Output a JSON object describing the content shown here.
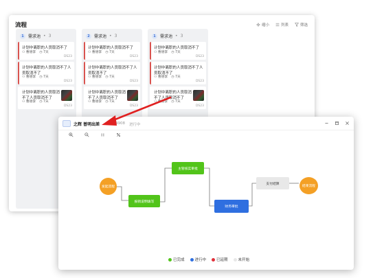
{
  "kanban": {
    "title": "流程",
    "tools": [
      {
        "label": "缩小",
        "icon": "shrink-icon"
      },
      {
        "label": "列表",
        "icon": "list-icon"
      },
      {
        "label": "筛选",
        "icon": "filter-icon"
      }
    ],
    "columns": [
      {
        "num": "1",
        "name": "需求池",
        "count": "3",
        "cards": [
          {
            "title": "计划中离职的人员取消不了",
            "assignee": "曹德李",
            "duration": "7天",
            "code": "DS23"
          },
          {
            "title": "计划中离职的人员取消不了人员取消不了",
            "assignee": "曹德李",
            "duration": "7天",
            "code": "DS23"
          },
          {
            "title": "计划中离职的人员取消不了人员取消不了",
            "assignee": "曹德李",
            "duration": "7天",
            "code": "DS23"
          }
        ]
      },
      {
        "num": "2",
        "name": "需求池",
        "count": "3",
        "cards": [
          {
            "title": "计划中离职的人员取消不了",
            "assignee": "曹德李",
            "duration": "7天",
            "code": "DS23"
          },
          {
            "title": "计划中离职的人员取消不了人员取消不了",
            "assignee": "曹德李",
            "duration": "7天",
            "code": "DS23"
          },
          {
            "title": "计划中离职的人员取消不了人员取消不了",
            "assignee": "曹德李",
            "duration": "7天",
            "code": "DS23"
          }
        ]
      },
      {
        "num": "1",
        "name": "需求池",
        "count": "3",
        "cards": [
          {
            "title": "计划中离职的人员取消不了",
            "assignee": "曹德李",
            "duration": "7天",
            "code": "DS23"
          },
          {
            "title": "计划中离职的人员取消不了人员取消不了",
            "assignee": "曹德李",
            "duration": "7天",
            "code": "DS23"
          },
          {
            "title": "计划中离职的人员取消不了人员取消不了",
            "assignee": "曹德李",
            "duration": "7天",
            "code": "DS23"
          }
        ]
      }
    ]
  },
  "flow_window": {
    "title": "之辉 普明出差",
    "id": "4908",
    "status": "进行中",
    "nodes": {
      "start": "发起流程",
      "fill": "报销说明填写",
      "supervisor": "主管核实审批",
      "finance": "财务审批",
      "pay": "支付结算",
      "end": "结束流程"
    },
    "legend": [
      {
        "label": "已完成",
        "color": "#52c41a"
      },
      {
        "label": "进行中",
        "color": "#2f6fe0"
      },
      {
        "label": "已延期",
        "color": "#e0303a"
      },
      {
        "label": "未开始",
        "color": "#e8e8e8"
      }
    ]
  },
  "colors": {
    "completed": "#52c41a",
    "in_progress": "#2f6fe0",
    "start_end": "#f4a025",
    "not_started": "#e8e8e8",
    "card_border": "#d9534f",
    "arrow": "#e02020"
  }
}
